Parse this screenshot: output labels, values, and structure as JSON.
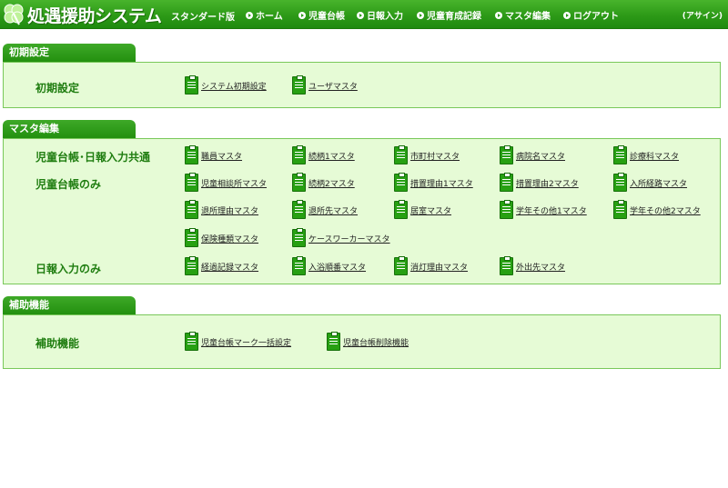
{
  "header": {
    "title": "処遇援助システム",
    "edition": "スタンダード版",
    "nav": [
      "ホーム",
      "児童台帳",
      "日報入力",
      "児童育成記録",
      "マスタ編集",
      "ログアウト"
    ],
    "signin": "(アサイン)"
  },
  "sections": {
    "initial": {
      "title": "初期設定",
      "rows": [
        {
          "label": "初期設定",
          "items": [
            "システム初期設定",
            "ユーザマスタ"
          ]
        }
      ]
    },
    "master": {
      "title": "マスタ編集",
      "rows": [
        {
          "label": "児童台帳･日報入力共通",
          "items": [
            "職員マスタ",
            "続柄1マスタ",
            "市町村マスタ",
            "病院名マスタ",
            "診療科マスタ"
          ]
        },
        {
          "label": "児童台帳のみ",
          "items": [
            "児童相談所マスタ",
            "続柄2マスタ",
            "措置理由1マスタ",
            "措置理由2マスタ",
            "入所経路マスタ"
          ]
        },
        {
          "label": "",
          "items": [
            "退所理由マスタ",
            "退所先マスタ",
            "居室マスタ",
            "学年その他1マスタ",
            "学年その他2マスタ"
          ]
        },
        {
          "label": "",
          "items": [
            "保険種類マスタ",
            "ケースワーカーマスタ"
          ]
        },
        {
          "label": "日報入力のみ",
          "items": [
            "経過記録マスタ",
            "入浴順番マスタ",
            "消灯理由マスタ",
            "外出先マスタ"
          ]
        }
      ]
    },
    "support": {
      "title": "補助機能",
      "rows": [
        {
          "label": "補助機能",
          "items": [
            "児童台帳マーク一括設定",
            "児童台帳削除機能"
          ]
        }
      ]
    }
  }
}
